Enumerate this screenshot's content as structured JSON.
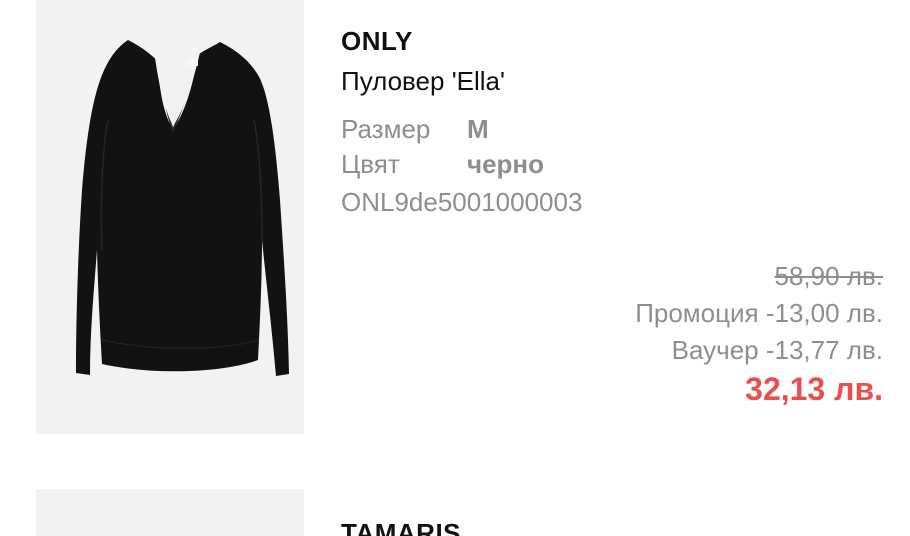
{
  "cart": {
    "items": [
      {
        "brand": "ONLY",
        "name": "Пуловер 'Ella'",
        "size_label": "Размер",
        "size_value": "M",
        "color_label": "Цвят",
        "color_value": "черно",
        "sku": "ONL9de5001000003",
        "old_price": "58,90 лв.",
        "promo": "Промоция -13,00 лв.",
        "voucher": "Ваучер -13,77 лв.",
        "final_price": "32,13 лв.",
        "image_icon": "black-sweater-image"
      },
      {
        "brand": "TAMARIS"
      }
    ]
  },
  "colors": {
    "final_price": "#e8504f",
    "muted_text": "#8e8e8e",
    "thumb_bg": "#f2f2f2"
  }
}
